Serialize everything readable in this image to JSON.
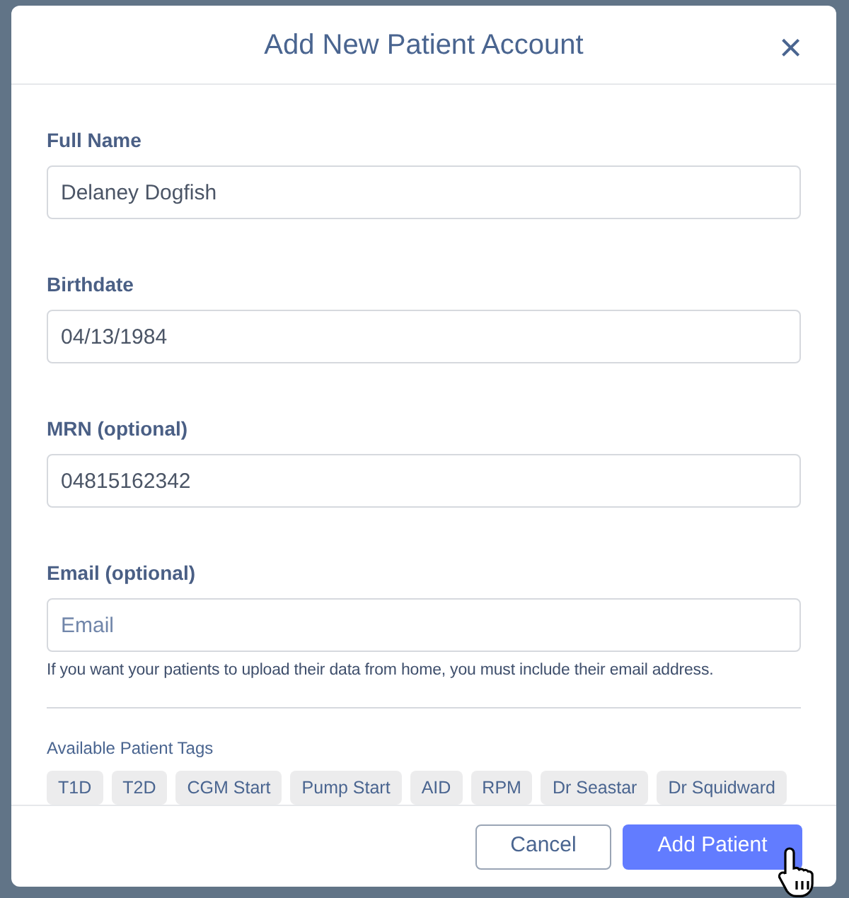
{
  "dialog": {
    "title": "Add New Patient Account",
    "close": "×"
  },
  "fields": [
    {
      "label": "Full Name",
      "value": "Delaney Dogfish"
    },
    {
      "label": "Birthdate",
      "value": "04/13/1984"
    },
    {
      "label": "MRN (optional)",
      "value": "04815162342"
    },
    {
      "label": "Email (optional)",
      "placeholder": "Email",
      "help": "If you want your patients to upload their data from home, you must include their email address."
    }
  ],
  "tags": {
    "label": "Available Patient Tags",
    "items": [
      "T1D",
      "T2D",
      "CGM Start",
      "Pump Start",
      "AID",
      "RPM",
      "Dr Seastar",
      "Dr Squidward"
    ]
  },
  "buttons": [
    {
      "label": "Cancel",
      "kind": "secondary"
    },
    {
      "label": "Add Patient",
      "kind": "primary"
    }
  ]
}
